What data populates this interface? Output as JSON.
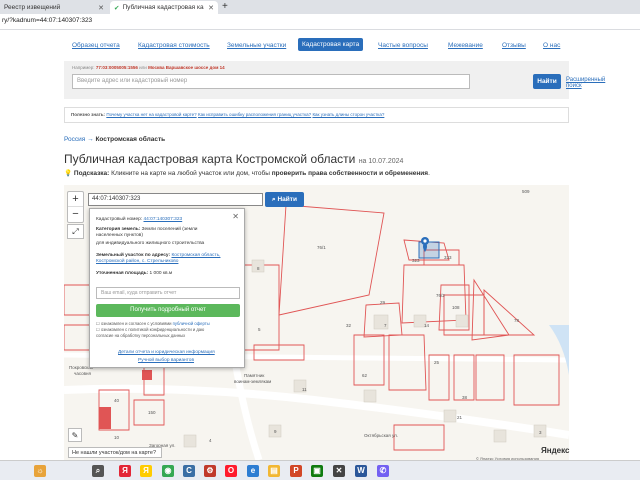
{
  "browser": {
    "tabs": [
      {
        "label": "Реестр извещений",
        "active": false
      },
      {
        "label": "Публичная кадастровая ка",
        "active": true
      }
    ],
    "url": "ry/?kadnum=44:07:140307:323"
  },
  "nav": {
    "items": [
      "Образец отчета",
      "Кадастровая стоимость",
      "Земельные участки",
      "Кадастровая карта",
      "Частые вопросы",
      "Межевание",
      "Отзывы",
      "О нас"
    ],
    "active_index": 3
  },
  "search": {
    "example_prefix": "Например:",
    "example_code": "77:03:0005005:1556",
    "example_or": "или",
    "example_address": "Москва Варшавское шоссе дом 14",
    "placeholder": "Введите адрес или кадастровый номер",
    "button": "Найти",
    "advanced": "Расширенный поиск"
  },
  "useful": {
    "prefix": "Полезно знать:",
    "link1": "Почему участка нет на кадастровой карте?",
    "link2": "Как исправить ошибку расположения границ участка?",
    "link3": "Как узнать длины сторон участка?"
  },
  "breadcrumb": {
    "root": "Россия",
    "sep": "→",
    "current": "Костромская область"
  },
  "page": {
    "title": "Публичная кадастровая карта Костромской области",
    "date": "на 10.07.2024",
    "tip_label": "Подсказка:",
    "tip_text": "Кликните на карте на любой участок или дом, чтобы",
    "tip_bold": "проверить права собственности и обременения",
    "tip_end": "."
  },
  "map": {
    "search_value": "44:07:140307:323",
    "search_button": "Найти",
    "not_found": "Не нашли участок/дом на карте?",
    "yandex": "Яндекс",
    "copyright": "© Яндекс Условия использования",
    "labels": [
      {
        "t": "509"
      },
      {
        "t": "76/1"
      },
      {
        "t": "323"
      },
      {
        "t": "323"
      },
      {
        "t": "8"
      },
      {
        "t": "29"
      },
      {
        "t": "108"
      },
      {
        "t": "76/2"
      },
      {
        "t": "14"
      },
      {
        "t": "7"
      },
      {
        "t": "78"
      },
      {
        "t": "32"
      },
      {
        "t": "5"
      },
      {
        "t": "62"
      },
      {
        "t": "25"
      },
      {
        "t": "38"
      },
      {
        "t": "40"
      },
      {
        "t": "150"
      },
      {
        "t": "21"
      },
      {
        "t": "10"
      },
      {
        "t": "11"
      },
      {
        "t": "3"
      },
      {
        "t": "4"
      },
      {
        "t": "9"
      },
      {
        "t": "Покровская"
      },
      {
        "t": "часовня"
      },
      {
        "t": "Памятник"
      },
      {
        "t": "воинам-землякам"
      },
      {
        "t": "Загорная ул."
      },
      {
        "t": "Октябрьская ул."
      }
    ]
  },
  "popup": {
    "cad_label": "Кадастровый номер:",
    "cad_value": "44:07:140307:323",
    "cat_label": "Категория земель:",
    "cat_value": "Земли поселений (земли",
    "cat_value2": "населенных пунктов)",
    "use_value": "для индивидуального жилищного строительства",
    "addr_label": "Земельный участок по адресу:",
    "addr_value": "Костромская область,",
    "addr_value2": "Костромской район, с. Стрельниково",
    "area_label": "Уточненная площадь:",
    "area_value": "1 000 кв.м",
    "email_placeholder": "Ваш email, куда отправить отчет",
    "get_button": "Получить подробный отчет",
    "consent1a": "ознакомлен и согласен с условиями",
    "consent1b": "публичной оферты",
    "consent1c": "ознакомлен с политикой конфиденциальности и даю",
    "consent2": "согласие на обработку персональных данных",
    "details_link": "Детали отчета и юридическая информация",
    "manual_link": "Ручной выбор вариантов"
  },
  "taskbar": {
    "icons": [
      {
        "name": "weather",
        "glyph": "☼",
        "color": "#e8a33a"
      },
      {
        "name": "search",
        "glyph": "⌕",
        "color": "#555555"
      },
      {
        "name": "yandex-browser",
        "glyph": "Я",
        "color": "#e32636"
      },
      {
        "name": "yandex",
        "glyph": "Я",
        "color": "#ffcc00"
      },
      {
        "name": "chrome",
        "glyph": "◉",
        "color": "#34a853"
      },
      {
        "name": "app-c",
        "glyph": "С",
        "color": "#3a6ea5"
      },
      {
        "name": "app-settings",
        "glyph": "⚙",
        "color": "#c0392b"
      },
      {
        "name": "opera",
        "glyph": "O",
        "color": "#ff1b2d"
      },
      {
        "name": "app-e",
        "glyph": "e",
        "color": "#2d7dd2"
      },
      {
        "name": "explorer",
        "glyph": "▤",
        "color": "#f2b733"
      },
      {
        "name": "app-p",
        "glyph": "P",
        "color": "#d24726"
      },
      {
        "name": "app-m",
        "glyph": "▣",
        "color": "#0f7b0f"
      },
      {
        "name": "app-x",
        "glyph": "✕",
        "color": "#444444"
      },
      {
        "name": "word",
        "glyph": "W",
        "color": "#2b579a"
      },
      {
        "name": "viber",
        "glyph": "✆",
        "color": "#7360f2"
      }
    ]
  }
}
